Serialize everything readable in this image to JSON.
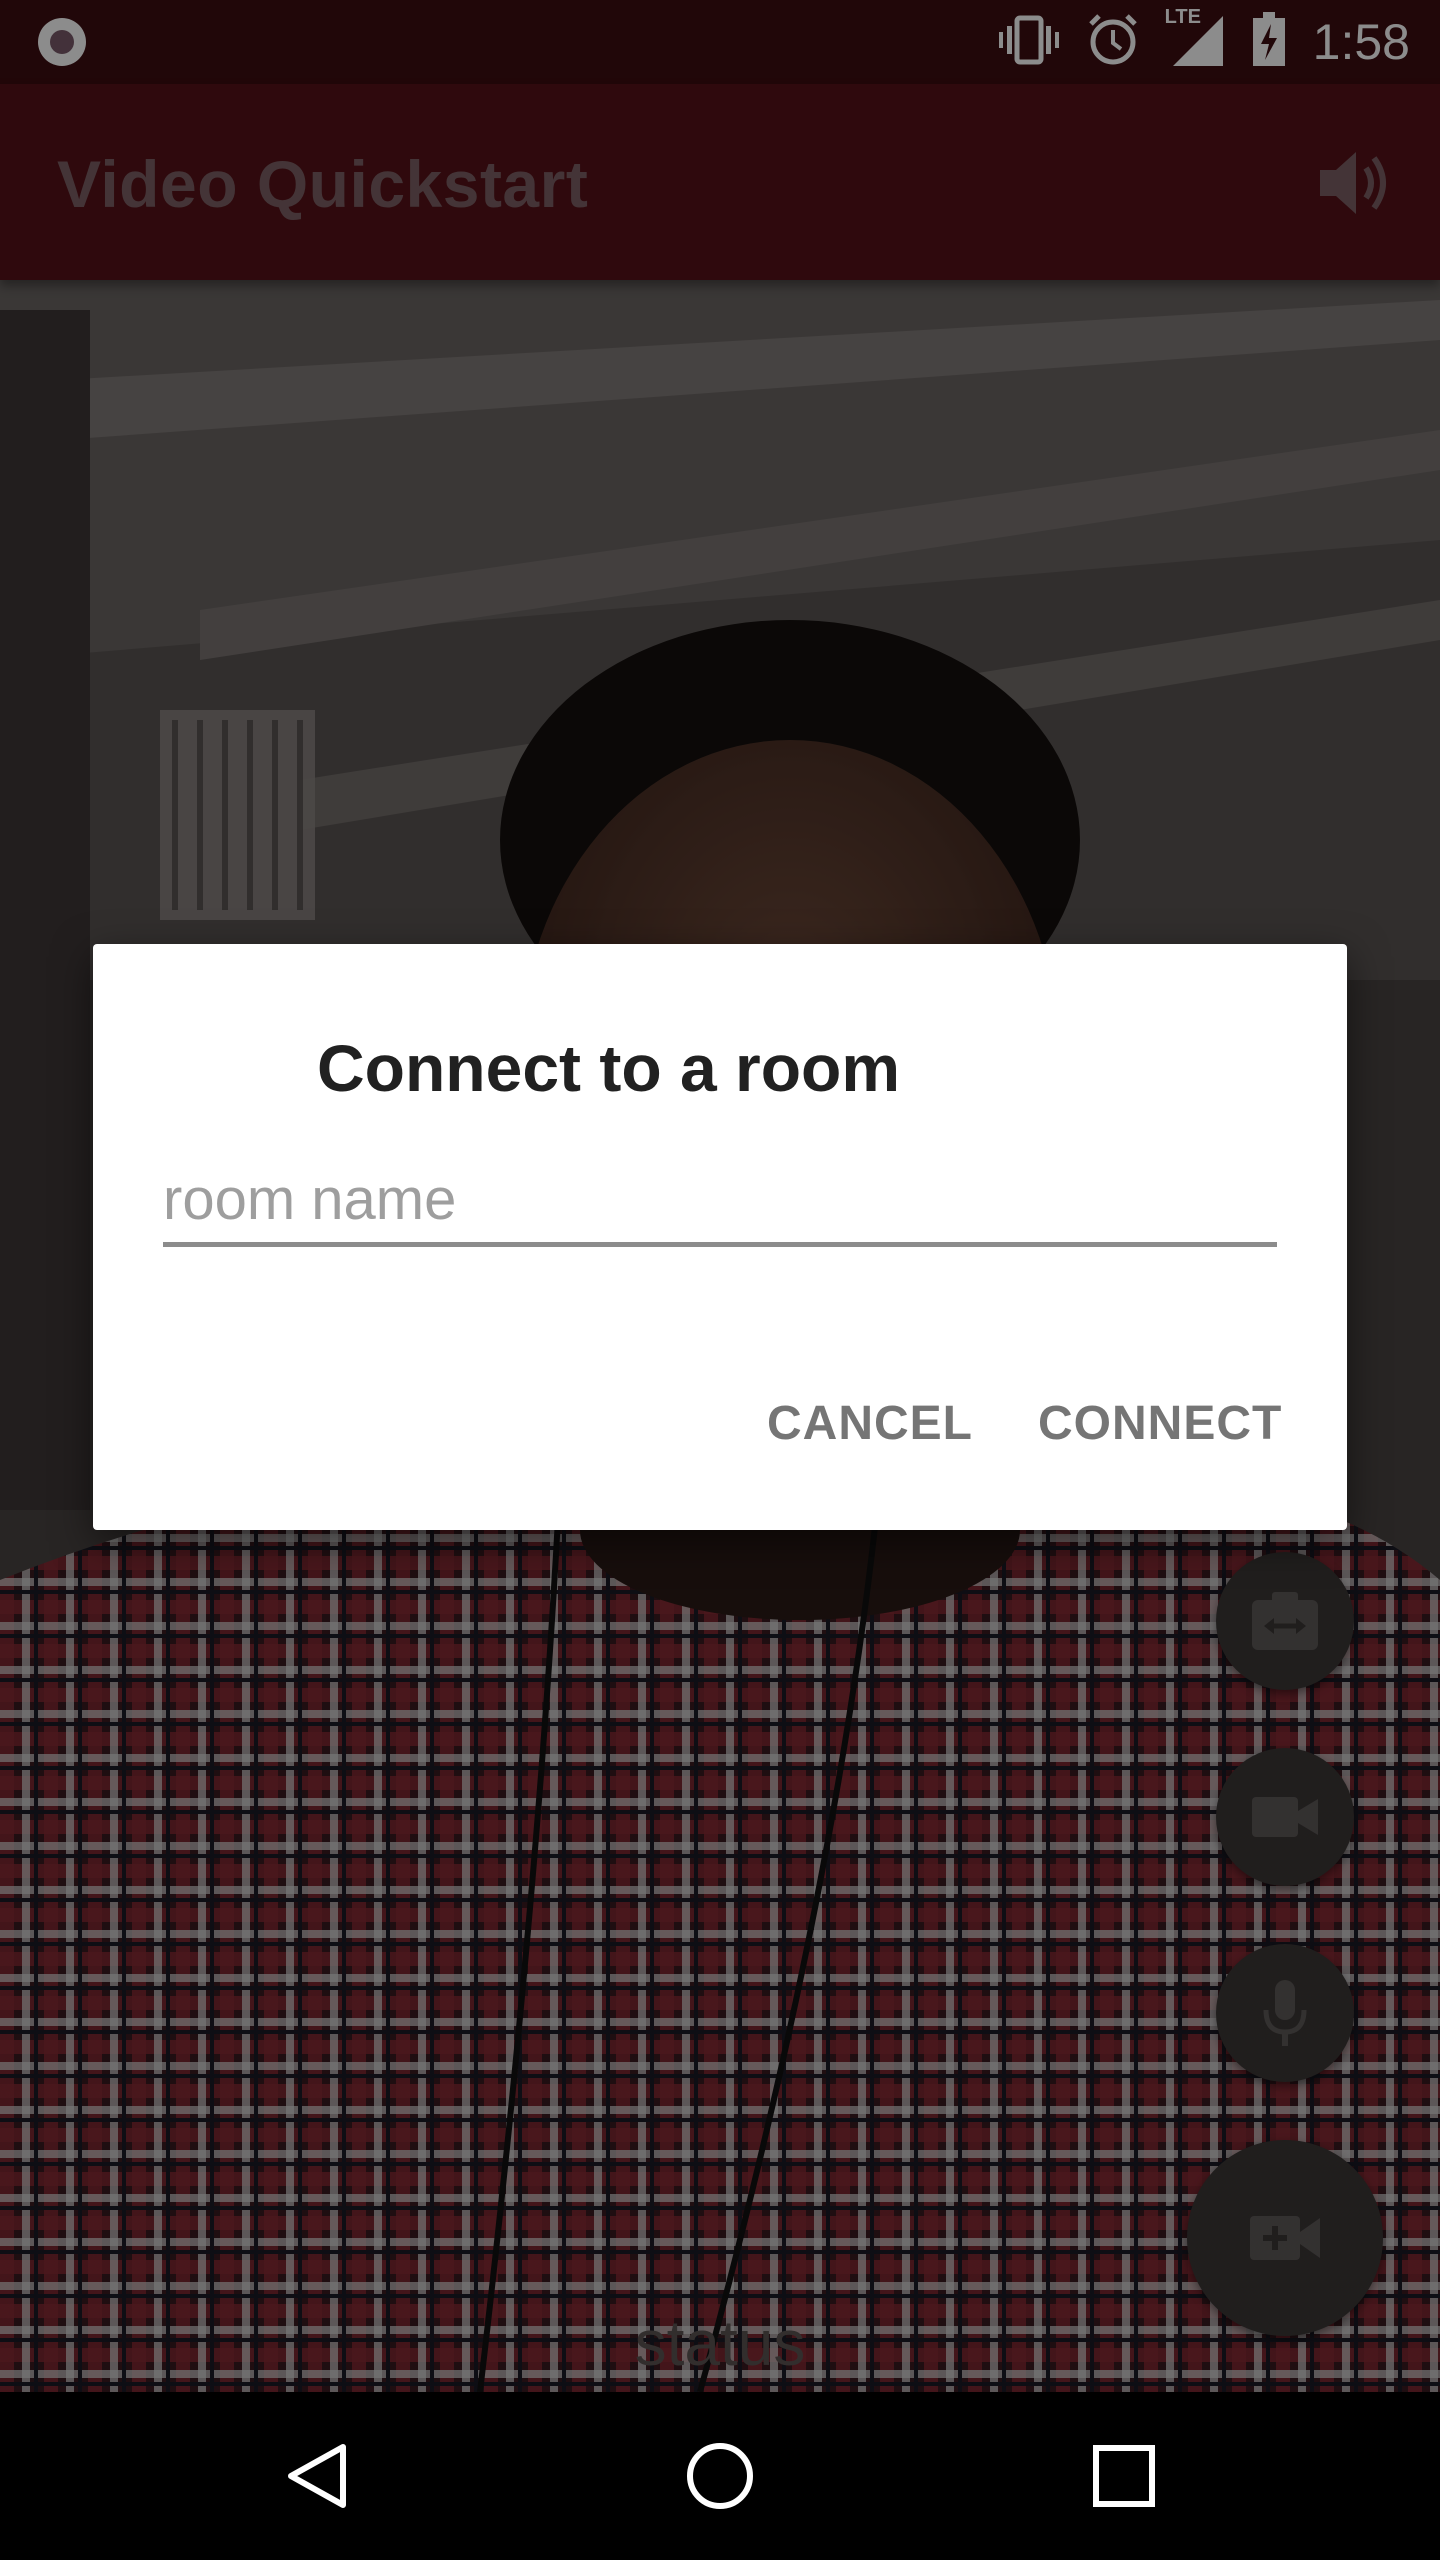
{
  "status_bar": {
    "time": "1:58",
    "network": "LTE",
    "icons": [
      "record-icon",
      "vibrate-icon",
      "alarm-icon",
      "signal-icon",
      "battery-charging-icon"
    ]
  },
  "app_bar": {
    "title": "Video Quickstart",
    "action_icon": "volume-icon"
  },
  "dialog": {
    "title": "Connect to a room",
    "input_placeholder": "room name",
    "input_value": "",
    "cancel_label": "CANCEL",
    "connect_label": "CONNECT"
  },
  "fabs": {
    "switch_camera_icon": "switch-camera-icon",
    "local_video_icon": "videocam-icon",
    "mute_icon": "mic-icon",
    "connect_icon": "video-call-icon"
  },
  "status_text": "status",
  "nav_bar": {
    "icons": [
      "back-icon",
      "home-icon",
      "recents-icon"
    ]
  },
  "colors": {
    "status_bar": "#3d0d11",
    "app_bar": "#561219",
    "dialog_background": "#ffffff",
    "fab": "#3b3736"
  }
}
